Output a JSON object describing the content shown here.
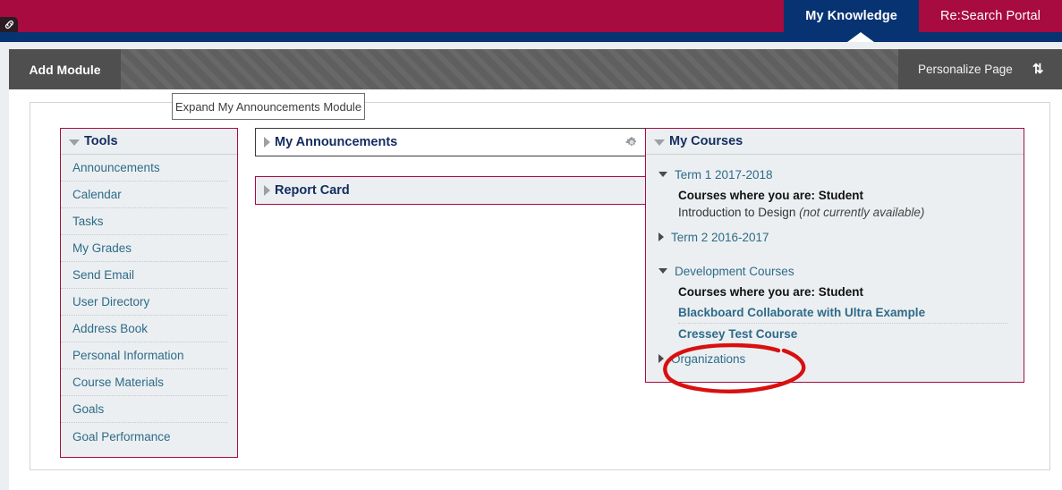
{
  "header": {
    "corner_icon": "link-icon",
    "tabs": [
      {
        "label": "My Knowledge",
        "active": true
      },
      {
        "label": "Re:Search Portal",
        "active": false
      }
    ],
    "colors": {
      "maroon": "#a80b3f",
      "navy": "#083372"
    }
  },
  "toolbar": {
    "add_module_label": "Add Module",
    "personalize_label": "Personalize Page",
    "sort_icon": "sort-updown-icon"
  },
  "tooltip": {
    "text": "Expand My Announcements Module"
  },
  "tools_module": {
    "title": "Tools",
    "collapse_icon": "triangle-down-icon",
    "items": [
      {
        "label": "Announcements"
      },
      {
        "label": "Calendar"
      },
      {
        "label": "Tasks"
      },
      {
        "label": "My Grades"
      },
      {
        "label": "Send Email"
      },
      {
        "label": "User Directory"
      },
      {
        "label": "Address Book"
      },
      {
        "label": "Personal Information"
      },
      {
        "label": "Course Materials"
      },
      {
        "label": "Goals"
      },
      {
        "label": "Goal Performance"
      }
    ]
  },
  "announcements_module": {
    "title": "My Announcements",
    "expand_icon": "triangle-right-icon",
    "settings_icon": "gear-icon"
  },
  "report_card_module": {
    "title": "Report Card",
    "expand_icon": "triangle-right-icon"
  },
  "courses_module": {
    "title": "My Courses",
    "collapse_icon": "triangle-down-icon",
    "groups": [
      {
        "name": "Term 1 2017-2018",
        "expanded": true,
        "role_line": "Courses where you are: Student",
        "courses": [
          {
            "name": "Introduction to Design",
            "note": "(not currently available)",
            "link": false
          }
        ]
      },
      {
        "name": "Term 2 2016-2017",
        "expanded": false,
        "role_line": "",
        "courses": []
      },
      {
        "name": "Development Courses",
        "expanded": true,
        "role_line": "Courses where you are: Student",
        "courses": [
          {
            "name": "Blackboard Collaborate with Ultra Example",
            "note": "",
            "link": true
          },
          {
            "name": "Cressey Test Course",
            "note": "",
            "link": true,
            "highlighted": true
          }
        ]
      },
      {
        "name": "Organizations",
        "expanded": false,
        "role_line": "",
        "courses": []
      }
    ]
  },
  "annotation": {
    "shape": "ellipse",
    "color": "#d81010",
    "target": "Cressey Test Course"
  }
}
